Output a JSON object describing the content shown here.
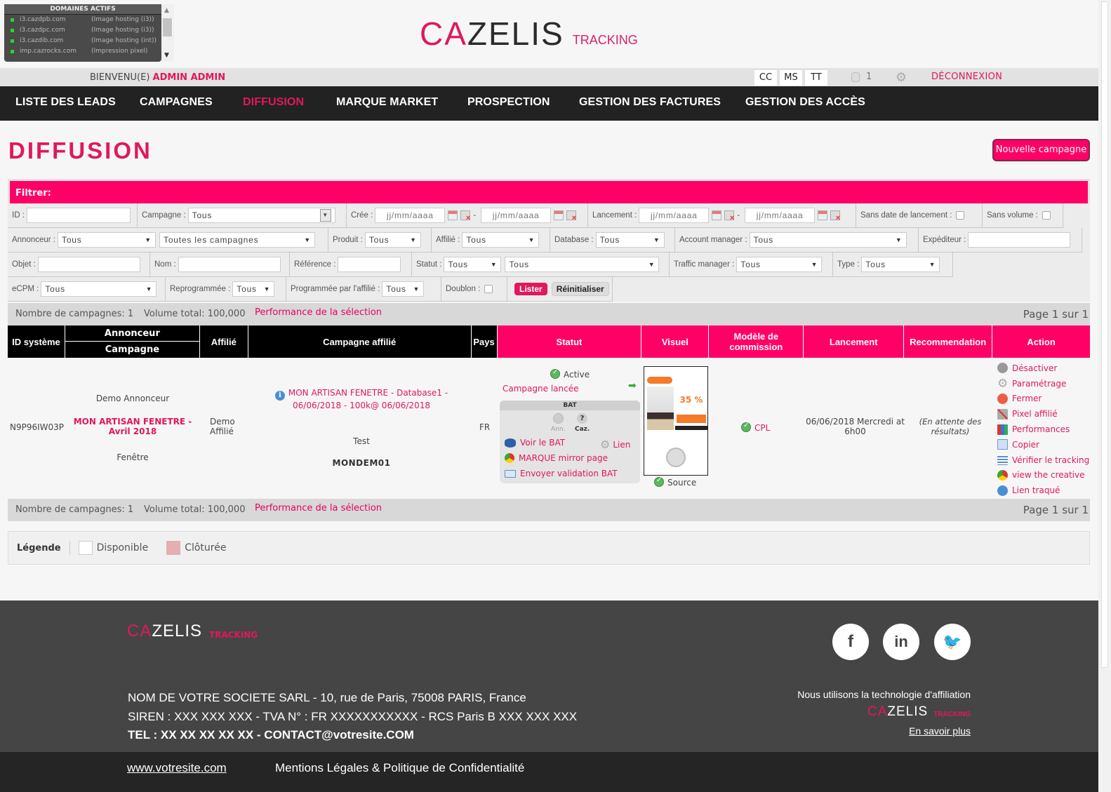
{
  "domains_widget": {
    "title": "DOMAINES ACTIFS",
    "items": [
      {
        "domain": "i3.cazdpb.com",
        "desc": "(Image hosting (i3))"
      },
      {
        "domain": "i3.cazdpc.com",
        "desc": "(Image hosting (i3))"
      },
      {
        "domain": "i3.cazdib.com",
        "desc": "(Image hosting (int))"
      },
      {
        "domain": "imp.cazrocks.com",
        "desc": "(Impression pixel)"
      }
    ]
  },
  "logo": {
    "ca": "CA",
    "zelis": "ZELIS",
    "tracking": "TRACKING"
  },
  "topbar": {
    "welcome": "BIENVENU(E)",
    "user": "ADMIN ADMIN",
    "buttons": [
      "CC",
      "MS",
      "TT"
    ],
    "db_count": "1",
    "logout": "DÉCONNEXION"
  },
  "nav": {
    "items": [
      {
        "label": "LISTE DES LEADS",
        "active": false
      },
      {
        "label": "CAMPAGNES",
        "active": false
      },
      {
        "label": "DIFFUSION",
        "active": true
      },
      {
        "label": "MARQUE MARKET",
        "active": false
      },
      {
        "label": "PROSPECTION",
        "active": false
      },
      {
        "label": "GESTION DES FACTURES",
        "active": false
      },
      {
        "label": "GESTION DES ACCÈS",
        "active": false
      }
    ]
  },
  "page": {
    "title": "DIFFUSION",
    "new_campaign": "Nouvelle campagne"
  },
  "filter": {
    "title": "Filtrer:",
    "id_label": "ID :",
    "campagne_label": "Campagne :",
    "campagne_value": "Tous",
    "cree_label": "Crée :",
    "date_placeholder": "jj/mm/aaaa",
    "lancement_label": "Lancement :",
    "sans_date_label": "Sans date de lancement :",
    "sans_volume_label": "Sans volume :",
    "annonceur_label": "Annonceur :",
    "annonceur_value": "Tous",
    "campagnes_value": "Toutes les campagnes",
    "produit_label": "Produit :",
    "produit_value": "Tous",
    "affilie_label": "Affilié :",
    "affilie_value": "Tous",
    "database_label": "Database :",
    "database_value": "Tous",
    "account_label": "Account manager :",
    "account_value": "Tous",
    "expediteur_label": "Expéditeur :",
    "objet_label": "Objet :",
    "nom_label": "Nom :",
    "reference_label": "Référence :",
    "statut_label": "Statut :",
    "statut_value": "Tous",
    "statut2_value": "Tous",
    "traffic_label": "Traffic manager :",
    "traffic_value": "Tous",
    "type_label": "Type :",
    "type_value": "Tous",
    "ecpm_label": "eCPM :",
    "ecpm_value": "Tous",
    "reprog_label": "Reprogrammée :",
    "reprog_value": "Tous",
    "prog_affilie_label": "Programmée par l'affilié :",
    "prog_affilie_value": "Tous",
    "doublon_label": "Doublon :",
    "lister": "Lister",
    "reinit": "Réinitialiser"
  },
  "summary": {
    "count": "Nombre de campagnes: 1",
    "volume": "Volume total: 100,000",
    "perf_link": "Performance de la sélection",
    "page": "Page 1 sur 1"
  },
  "table": {
    "headers": {
      "id": "ID système",
      "annonceur": "Annonceur",
      "campagne": "Campagne",
      "affilie": "Affilié",
      "campagne_affilie": "Campagne affilié",
      "pays": "Pays",
      "statut": "Statut",
      "visuel": "Visuel",
      "modele": "Modèle de commission",
      "lancement": "Lancement",
      "recommandation": "Recommendation",
      "action": "Action"
    },
    "row": {
      "id": "N9P96IW03P",
      "annonceur": "Demo Annonceur",
      "campagne": "MON ARTISAN FENETRE - Avril 2018",
      "produit": "Fenêtre",
      "affilie": "Demo Affilié",
      "campagne_affilie": "MON ARTISAN FENETRE - Database1 - 06/06/2018 - 100k@ 06/06/2018",
      "campagne_affilie_sub": "Test",
      "campagne_affilie_code": "MONDEM01",
      "pays": "FR",
      "statut": "Active",
      "statut_link": "Campagne lancée",
      "bat": {
        "title": "BAT",
        "ann": "Ann.",
        "caz": "Caz.",
        "voir": "Voir le BAT",
        "lien": "Lien",
        "mirror": "MARQUE mirror page",
        "envoyer": "Envoyer validation BAT"
      },
      "visuel_source": "Source",
      "visuel_promo": "35 %",
      "modele": "CPL",
      "lancement": "06/06/2018 Mercredi at 6h00",
      "recommandation": "(En attente des résultats)",
      "actions": [
        {
          "label": "Désactiver",
          "icon": "deactivate-icon"
        },
        {
          "label": "Paramétrage",
          "icon": "gear-icon"
        },
        {
          "label": "Fermer",
          "icon": "close-icon"
        },
        {
          "label": "Pixel affilié",
          "icon": "pixel-icon"
        },
        {
          "label": "Performances",
          "icon": "bar-chart-icon"
        },
        {
          "label": "Copier",
          "icon": "copy-icon"
        },
        {
          "label": "Vérifier le tracking",
          "icon": "checklist-icon"
        },
        {
          "label": "view the creative",
          "icon": "chrome-icon"
        },
        {
          "label": "Lien traqué",
          "icon": "info-icon"
        }
      ]
    }
  },
  "legend": {
    "title": "Légende",
    "items": [
      {
        "label": "Disponible",
        "color": "#ffffff"
      },
      {
        "label": "Clôturée",
        "color": "#e6aeb2"
      }
    ]
  },
  "footer": {
    "address": "NOM DE VOTRE SOCIETE SARL - 10, rue de Paris, 75008 PARIS, France",
    "siren": "SIREN : XXX XXX XXX - TVA N° : FR XXXXXXXXXXX - RCS Paris B XXX XXX XXX",
    "contact": "TEL : XX XX XX XX XX - CONTACT@votresite.COM",
    "social": [
      "f",
      "in",
      "🐦"
    ],
    "tech": "Nous utilisons la technologie d'affiliation",
    "learn_more": "En savoir plus",
    "website": "www.votresite.com",
    "legal": "Mentions Légales & Politique de Confidentialité"
  },
  "colors": {
    "brand": "#e0185c",
    "header_pink": "#ff0066",
    "nav_bg": "#222222",
    "footer_bg": "#454545"
  }
}
